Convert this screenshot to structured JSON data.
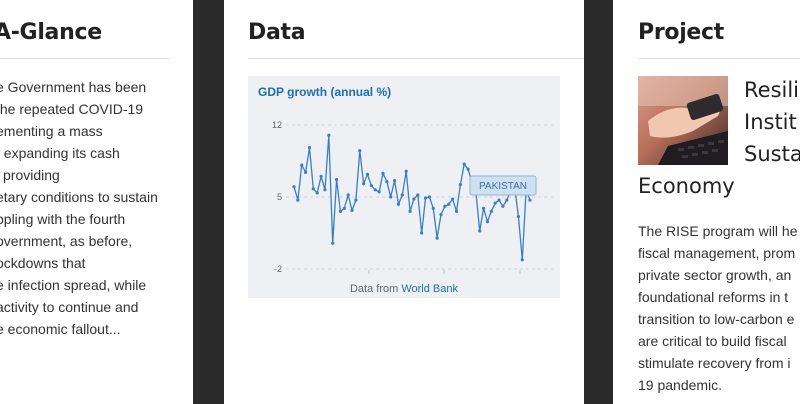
{
  "glance": {
    "title": "A-Glance",
    "lines": [
      "e Government has been",
      "the repeated COVID-19",
      "ementing a mass",
      ", expanding its cash",
      "l providing",
      "etary conditions to sustain",
      "ppling with the fourth",
      "overnment, as before,",
      "ockdowns that",
      "e infection spread, while",
      "activity to continue and",
      "e economic fallout..."
    ]
  },
  "data_panel": {
    "title": "Data",
    "chart_title": "GDP growth (annual %)",
    "series_label": "PAKISTAN",
    "source_prefix": "Data from ",
    "source_link": "World Bank"
  },
  "chart_data": {
    "type": "line",
    "title": "GDP growth (annual %)",
    "y_ticks": [
      "12",
      "5",
      "-2"
    ],
    "ylim": [
      -2,
      12
    ],
    "grid": true,
    "line_color": "#3a7fc1",
    "series": [
      {
        "name": "PAKISTAN",
        "values": [
          6.0,
          4.7,
          8.1,
          7.4,
          9.8,
          5.8,
          5.4,
          7.0,
          5.7,
          11.0,
          0.5,
          6.7,
          3.6,
          3.9,
          5.2,
          3.7,
          4.7,
          9.5,
          6.3,
          7.2,
          6.1,
          5.7,
          5.5,
          7.3,
          6.5,
          5.0,
          6.6,
          4.3,
          5.2,
          7.5,
          3.6,
          4.8,
          5.2,
          1.5,
          4.9,
          5.0,
          3.9,
          1.0,
          3.3,
          4.1,
          4.3,
          4.8,
          3.6,
          6.2,
          8.2,
          7.7,
          6.4,
          5.6,
          1.7,
          3.9,
          2.6,
          3.6,
          4.4,
          4.7,
          4.1,
          4.7,
          5.6,
          6.1,
          3.1,
          -1.1,
          5.7,
          4.7
        ]
      }
    ]
  },
  "project": {
    "title": "Project",
    "heading_lines": [
      "Resili",
      "Instit",
      "Susta",
      "Economy"
    ],
    "lines": [
      "The RISE program will he",
      "fiscal management, prom",
      "private sector growth, an",
      "foundational reforms in t",
      "transition to low-carbon e",
      "are critical to build fiscal",
      "stimulate recovery from i",
      "19 pandemic."
    ]
  }
}
